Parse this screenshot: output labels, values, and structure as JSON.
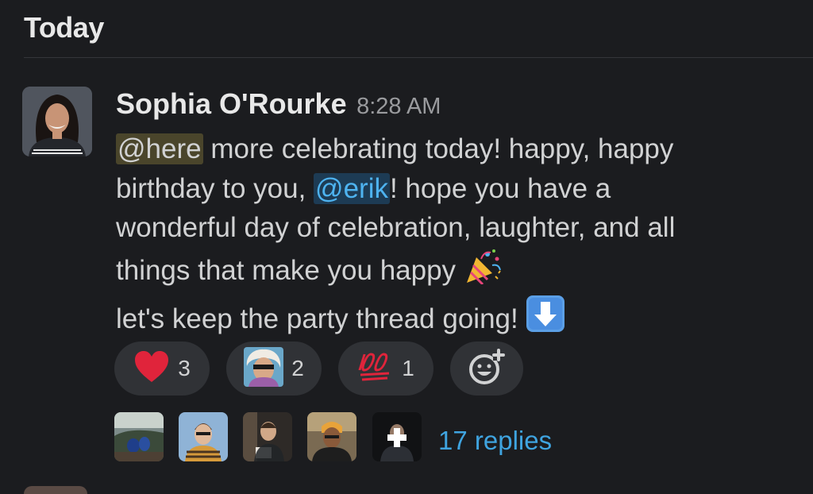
{
  "day_header": "Today",
  "message": {
    "sender": "Sophia O'Rourke",
    "time": "8:28 AM",
    "mention_here": "@here",
    "text_1": " more celebrating today! happy, happy",
    "text_2": "birthday to you, ",
    "mention_user": "@erik",
    "text_3": "! hope you have a",
    "text_4": "wonderful day of celebration, laughter, and all",
    "text_5": "things that make you happy ",
    "text_6": "let's keep the party thread going! ",
    "inline_icons": [
      "party-popper-icon",
      "down-arrow-emoji-icon"
    ]
  },
  "reactions": [
    {
      "icon": "heart-icon",
      "count": "3"
    },
    {
      "icon": "person-photo-emoji-icon",
      "count": "2"
    },
    {
      "icon": "hundred-points-icon",
      "count": "1"
    }
  ],
  "thread": {
    "participants": [
      "participant-avatar-1",
      "participant-avatar-2",
      "participant-avatar-3",
      "participant-avatar-4",
      "participant-avatar-5"
    ],
    "replies": "17 replies"
  },
  "colors": {
    "background": "#1b1c1f",
    "link": "#3fa4e0",
    "mention_user_bg": "#1d3b54",
    "mention_here_bg": "#4a452b",
    "pill": "#303236"
  }
}
